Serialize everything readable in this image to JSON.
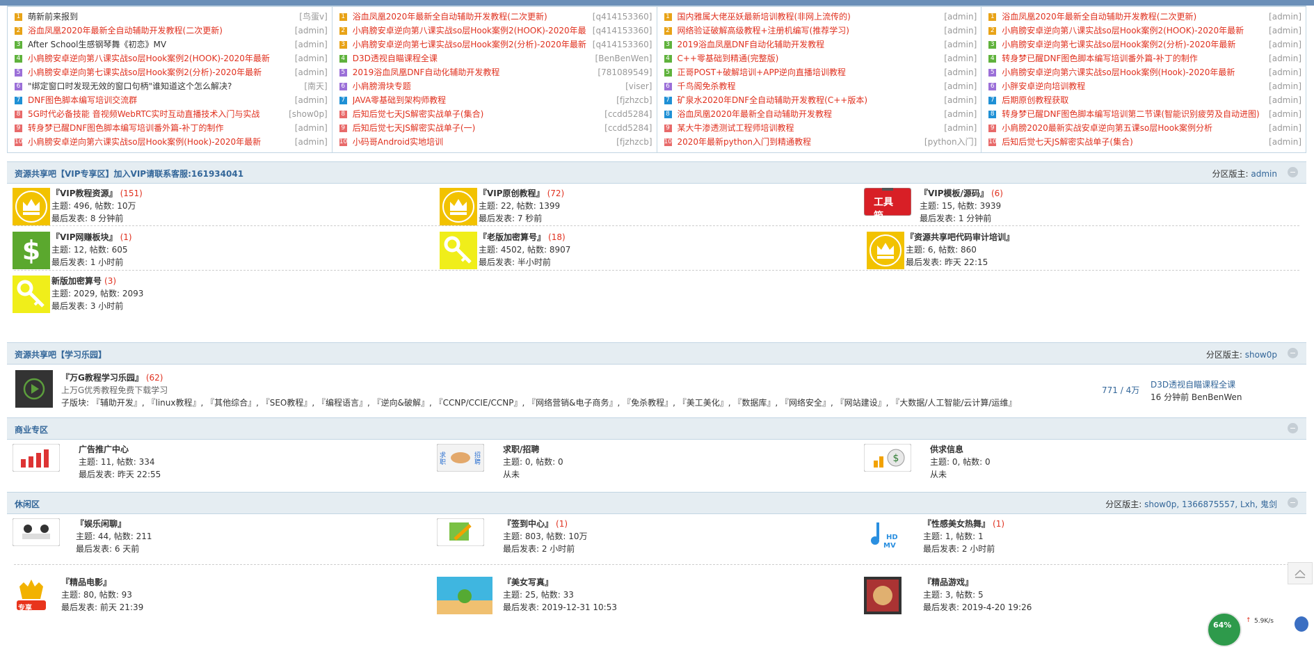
{
  "latest": {
    "columns": [
      [
        {
          "n": "1",
          "title": "萌新前来报到",
          "author": "[鸟蛋v]",
          "red": false
        },
        {
          "n": "2",
          "title": "浴血凤凰2020年最新全自动辅助开发教程(二次更新)",
          "author": "[admin]",
          "red": true
        },
        {
          "n": "3",
          "title": "After School生感钢琴舞《初恋》MV",
          "author": "[admin]",
          "red": false
        },
        {
          "n": "4",
          "title": "小肩膀安卓逆向第八课实战so层Hook案例2(HOOK)-2020年最新",
          "author": "[admin]",
          "red": true
        },
        {
          "n": "5",
          "title": "小肩膀安卓逆向第七课实战so层Hook案例2(分析)-2020年最新",
          "author": "[admin]",
          "red": true
        },
        {
          "n": "6",
          "title": "\"绑定窗口时发现无效的窗口句柄\"谁知道这个怎么解决?",
          "author": "[南天]",
          "red": false
        },
        {
          "n": "7",
          "title": "DNF图色脚本编写培训交流群",
          "author": "[admin]",
          "red": true
        },
        {
          "n": "8",
          "title": "5G时代必备技能 音视频WebRTC实时互动直播技术入门与实战",
          "author": "[show0p]",
          "red": true
        },
        {
          "n": "9",
          "title": "转身梦已醒DNF图色脚本编写培训番外篇-补丁的制作",
          "author": "[admin]",
          "red": true
        },
        {
          "n": "10",
          "title": "小肩膀安卓逆向第六课实战so层Hook案例(Hook)-2020年最新",
          "author": "[admin]",
          "red": true
        }
      ],
      [
        {
          "n": "1",
          "title": "浴血凤凰2020年最新全自动辅助开发教程(二次更新)",
          "author": "[q414153360]",
          "red": true
        },
        {
          "n": "2",
          "title": "小肩膀安卓逆向第八课实战so层Hook案例2(HOOK)-2020年最",
          "author": "[q414153360]",
          "red": true
        },
        {
          "n": "3",
          "title": "小肩膀安卓逆向第七课实战so层Hook案例2(分析)-2020年最新",
          "author": "[q414153360]",
          "red": true
        },
        {
          "n": "4",
          "title": "D3D透视自瞄课程全课",
          "author": "[BenBenWen]",
          "red": true
        },
        {
          "n": "5",
          "title": "2019浴血凤凰DNF自动化辅助开发教程",
          "author": "[781089549]",
          "red": true
        },
        {
          "n": "6",
          "title": "小肩膀滑块专题",
          "author": "[viser]",
          "red": true
        },
        {
          "n": "7",
          "title": "JAVA零基础到架构师教程",
          "author": "[fjzhzcb]",
          "red": true
        },
        {
          "n": "8",
          "title": "后知后觉七天JS解密实战单子(集合)",
          "author": "[ccdd5284]",
          "red": true
        },
        {
          "n": "9",
          "title": "后知后觉七天JS解密实战单子(一)",
          "author": "[ccdd5284]",
          "red": true
        },
        {
          "n": "10",
          "title": "小码哥Android实地培训",
          "author": "[fjzhzcb]",
          "red": true
        }
      ],
      [
        {
          "n": "1",
          "title": "国内雅属大佬巫妖最新培训教程(非网上流传的)",
          "author": "[admin]",
          "red": true
        },
        {
          "n": "2",
          "title": "网络验证破解高级教程+注册机编写(推荐学习)",
          "author": "[admin]",
          "red": true
        },
        {
          "n": "3",
          "title": "2019浴血凤凰DNF自动化辅助开发教程",
          "author": "[admin]",
          "red": true
        },
        {
          "n": "4",
          "title": "C++零基础到精通(完整版)",
          "author": "[admin]",
          "red": true
        },
        {
          "n": "5",
          "title": "正哥POST+破解培训+APP逆向直播培训教程",
          "author": "[admin]",
          "red": true
        },
        {
          "n": "6",
          "title": "千鸟阁免杀教程",
          "author": "[admin]",
          "red": true
        },
        {
          "n": "7",
          "title": "矿泉水2020年DNF全自动辅助开发教程(C++版本)",
          "author": "[admin]",
          "red": true
        },
        {
          "n": "8",
          "title": "浴血凤凰2020年最新全自动辅助开发教程",
          "author": "[admin]",
          "red": true
        },
        {
          "n": "9",
          "title": "某大牛渗透测试工程师培训教程",
          "author": "[admin]",
          "red": true
        },
        {
          "n": "10",
          "title": "2020年最新python入门到精通教程",
          "author": "[python入门]",
          "red": true
        }
      ],
      [
        {
          "n": "1",
          "title": "浴血凤凰2020年最新全自动辅助开发教程(二次更新)",
          "author": "[admin]",
          "red": true
        },
        {
          "n": "2",
          "title": "小肩膀安卓逆向第八课实战so层Hook案例2(HOOK)-2020年最新",
          "author": "[admin]",
          "red": true
        },
        {
          "n": "3",
          "title": "小肩膀安卓逆向第七课实战so层Hook案例2(分析)-2020年最新",
          "author": "[admin]",
          "red": true
        },
        {
          "n": "4",
          "title": "转身梦已醒DNF图色脚本编写培训番外篇-补丁的制作",
          "author": "[admin]",
          "red": true
        },
        {
          "n": "5",
          "title": "小肩膀安卓逆向第六课实战so层Hook案例(Hook)-2020年最新",
          "author": "[admin]",
          "red": true
        },
        {
          "n": "6",
          "title": "小胖安卓逆向培训教程",
          "author": "[admin]",
          "red": true
        },
        {
          "n": "7",
          "title": "后期原创教程获取",
          "author": "[admin]",
          "red": true
        },
        {
          "n": "8",
          "title": "转身梦已醒DNF图色脚本编写培训第二节课(智能识别疲劳及自动进图)",
          "author": "[admin]",
          "red": true
        },
        {
          "n": "9",
          "title": "小肩膀2020最新实战安卓逆向第五课so层Hook案例分析",
          "author": "[admin]",
          "red": true
        },
        {
          "n": "10",
          "title": "后知后觉七天JS解密实战单子(集合)",
          "author": "[admin]",
          "red": true
        }
      ]
    ]
  },
  "vip": {
    "title": "资源共享吧【VIP专享区】加入VIP请联系客服:161934041",
    "mod_label": "分区版主: ",
    "mods": "admin",
    "forums": [
      {
        "name": "『VIP教程资源』",
        "count": "(151)",
        "stat": "主题: 496, 帖数: 10万",
        "last": "最后发表: 8 分钟前",
        "icon": "crown"
      },
      {
        "name": "『VIP原创教程』",
        "count": "(72)",
        "stat": "主题: 22, 帖数: 1399",
        "last": "最后发表: 7 秒前",
        "icon": "crown"
      },
      {
        "name": "『VIP模板/源码』",
        "count": "(6)",
        "stat": "主题: 15, 帖数: 3939",
        "last": "最后发表: 1 分钟前",
        "icon": "toolbox",
        "icon_text": "工具箱"
      },
      {
        "name": "『VIP网赚板块』",
        "count": "(1)",
        "stat": "主题: 12, 帖数: 605",
        "last": "最后发表: 1 小时前",
        "icon": "dollar"
      },
      {
        "name": "『老版加密算号』",
        "count": "(18)",
        "stat": "主题: 4502, 帖数: 8907",
        "last": "最后发表: 半小时前",
        "icon": "key"
      },
      {
        "name": "『资源共享吧代码审计培训』",
        "count": "",
        "stat": "主题: 6, 帖数: 860",
        "last": "最后发表: 昨天 22:15",
        "icon": "crown"
      },
      {
        "name": "新版加密算号",
        "count": "(3)",
        "stat": "主题: 2029, 帖数: 2093",
        "last": "最后发表: 3 小时前",
        "icon": "key"
      }
    ]
  },
  "study": {
    "title": "资源共享吧【学习乐园】",
    "mod_label": "分区版主: ",
    "mods": "show0p",
    "forum": {
      "name": "『万G教程学习乐园』",
      "count": "(62)",
      "desc": "上万G优秀教程免费下载学习",
      "sub": "子版块: 『辅助开发』, 『linux教程』, 『其他综合』, 『SEO教程』, 『编程语言』, 『逆向&破解』, 『CCNP/CCIE/CCNP』, 『网络营销&电子商务』, 『免杀教程』, 『美工美化』, 『数据库』, 『网络安全』, 『网站建设』, 『大数据/人工智能/云计算/运维』",
      "ratio": "771 / 4万",
      "last_title": "D3D透视自瞄课程全课",
      "last_info": "16 分钟前 BenBenWen"
    }
  },
  "biz": {
    "title": "商业专区",
    "forums": [
      {
        "name": "广告推广中心",
        "stat": "主题: 11, 帖数: 334",
        "last": "最后发表: 昨天 22:55",
        "icon": "bars"
      },
      {
        "name": "求职/招聘",
        "stat": "主题: 0, 帖数: 0",
        "last": "从未",
        "icon": "handshake",
        "icon_left": "求职",
        "icon_right": "招聘"
      },
      {
        "name": "供求信息",
        "stat": "主题: 0, 帖数: 0",
        "last": "从未",
        "icon": "moneybag"
      }
    ]
  },
  "leisure": {
    "title": "休闲区",
    "mod_label": "分区版主: ",
    "mods": "show0p, 1366875557, Lxh, 鬼剑",
    "forums": [
      {
        "name": "『娱乐闲聊』",
        "count": "",
        "stat": "主题: 44, 帖数: 211",
        "last": "最后发表: 6 天前",
        "icon": "chat"
      },
      {
        "name": "『签到中心』",
        "count": "(1)",
        "stat": "主题: 803, 帖数: 10万",
        "last": "最后发表: 2 小时前",
        "icon": "pencil"
      },
      {
        "name": "『性感美女热舞』",
        "count": "(1)",
        "stat": "主题: 1, 帖数: 1",
        "last": "最后发表: 2 小时前",
        "icon": "hdmv",
        "icon_text": "HD MV"
      },
      {
        "name": "『精品电影』",
        "count": "",
        "stat": "主题: 80, 帖数: 93",
        "last": "最后发表: 前天 21:39",
        "icon": "trophy",
        "icon_text": "专享"
      },
      {
        "name": "『美女写真』",
        "count": "",
        "stat": "主题: 25, 帖数: 33",
        "last": "最后发表: 2019-12-31 10:53",
        "icon": "beach"
      },
      {
        "name": "『精品游戏』",
        "count": "",
        "stat": "主题: 3, 帖数: 5",
        "last": "最后发表: 2019-4-20 19:26",
        "icon": "game"
      }
    ]
  },
  "widget": {
    "percent": "64%",
    "speed": "5.9K/s"
  },
  "colors": {
    "red": "#e0301e",
    "blue": "#336699",
    "header_bg": "#e5edf2",
    "border": "#c2d5e3"
  }
}
